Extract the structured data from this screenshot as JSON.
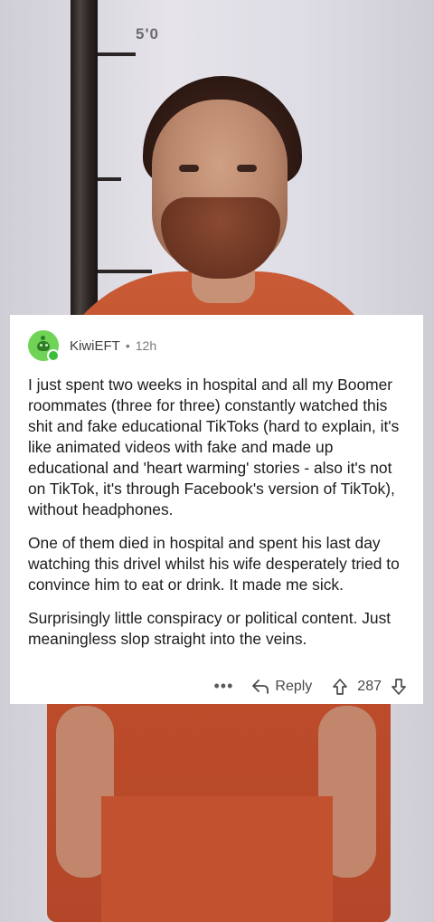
{
  "background": {
    "description_icon": "mugshot-photo",
    "height_marker_label": "5'0"
  },
  "comment": {
    "author": "KiwiEFT",
    "separator": "•",
    "age": "12h",
    "paragraphs": [
      "I just spent two weeks in hospital and all my Boomer roommates (three for three) constantly watched this shit and fake educational TikToks (hard to explain, it's like animated videos with fake and made up educational and 'heart warming' stories - also it's not on TikTok, it's through Facebook's version of TikTok), without headphones.",
      "One of them died in hospital and spent his last day watching this drivel whilst his wife desperately tried to convince him to eat or drink. It made me sick.",
      "Surprisingly little conspiracy or political content. Just meaningless slop straight into the veins."
    ],
    "actions": {
      "more_label": "•••",
      "reply_label": "Reply",
      "vote_count": "287"
    }
  },
  "colors": {
    "avatar": "#6fd356",
    "card_bg": "#ffffff",
    "jumpsuit": "#c85a36"
  }
}
